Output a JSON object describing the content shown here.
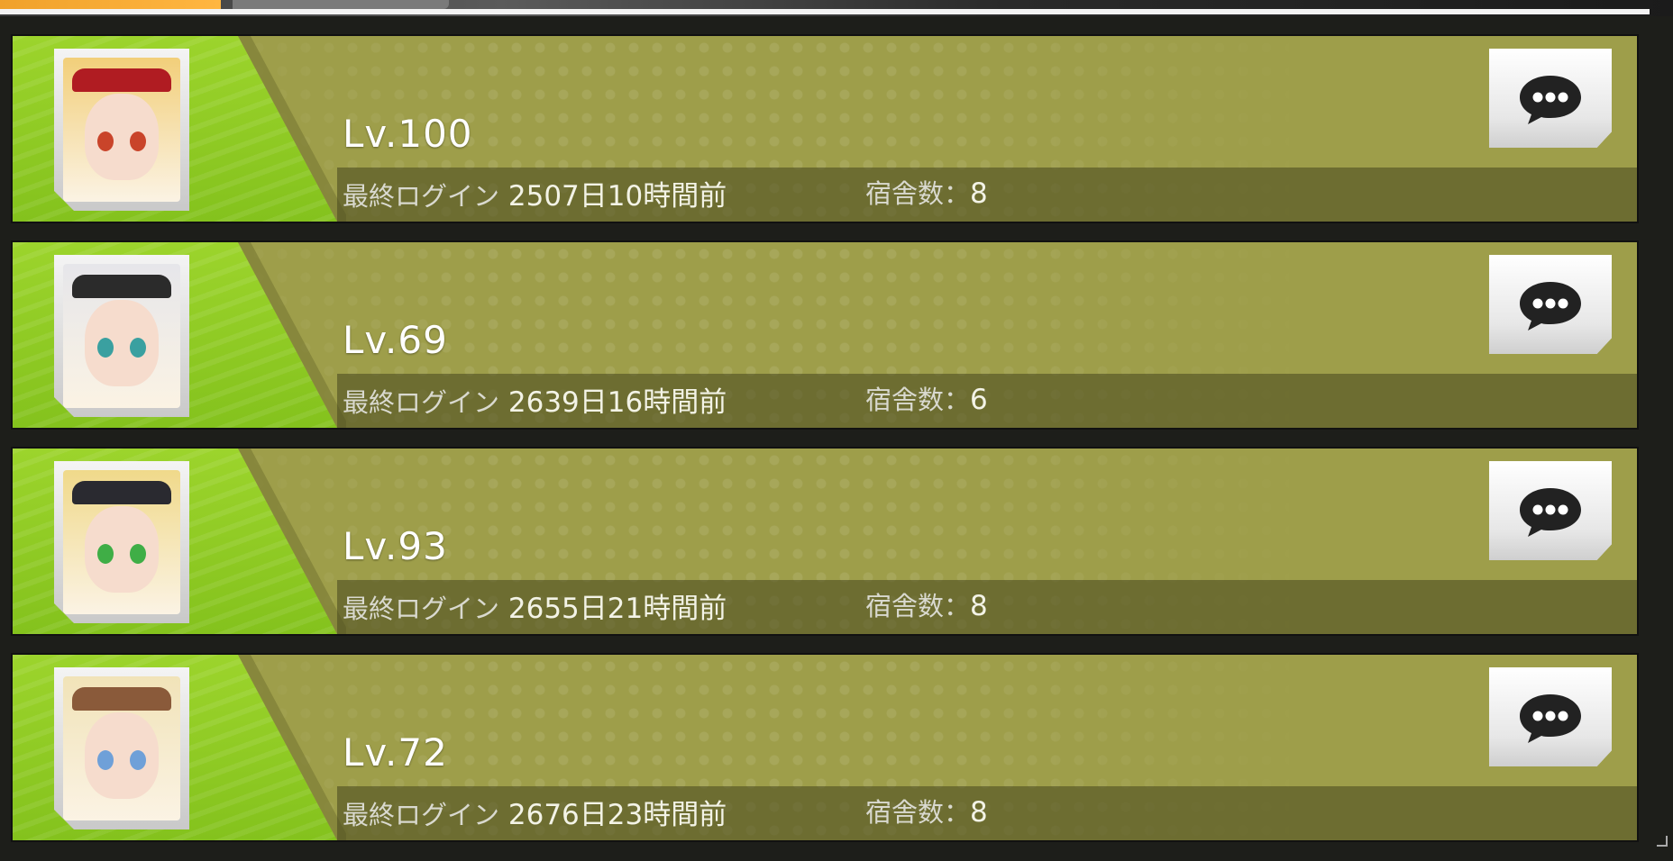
{
  "header": {
    "accent_color": "#f0a12b"
  },
  "friends": [
    {
      "level": "Lv.100",
      "login_label": "最終ログイン",
      "login_value": "2507日10時間前",
      "dorm_label": "宿舎数：",
      "dorm_value": "8",
      "avatar": {
        "hair": "#f2cf7a",
        "eye": "#c9442a",
        "accent": "#b01c22"
      }
    },
    {
      "level": "Lv.69",
      "login_label": "最終ログイン",
      "login_value": "2639日16時間前",
      "dorm_label": "宿舎数：",
      "dorm_value": "6",
      "avatar": {
        "hair": "#e6e6ea",
        "eye": "#3aa0a0",
        "accent": "#2b2b2b"
      }
    },
    {
      "level": "Lv.93",
      "login_label": "最終ログイン",
      "login_value": "2655日21時間前",
      "dorm_label": "宿舎数：",
      "dorm_value": "8",
      "avatar": {
        "hair": "#f0d98a",
        "eye": "#3fae46",
        "accent": "#2a2a30"
      }
    },
    {
      "level": "Lv.72",
      "login_label": "最終ログイン",
      "login_value": "2676日23時間前",
      "dorm_label": "宿舎数：",
      "dorm_value": "8",
      "avatar": {
        "hair": "#f1e3b8",
        "eye": "#6fa0d8",
        "accent": "#8a5a3a"
      }
    }
  ],
  "icons": {
    "chat": "chat-bubble-icon"
  },
  "colors": {
    "row_bg": "#9e9e4a",
    "stripe_green": "#9cd42c",
    "text": "#ffffff"
  }
}
